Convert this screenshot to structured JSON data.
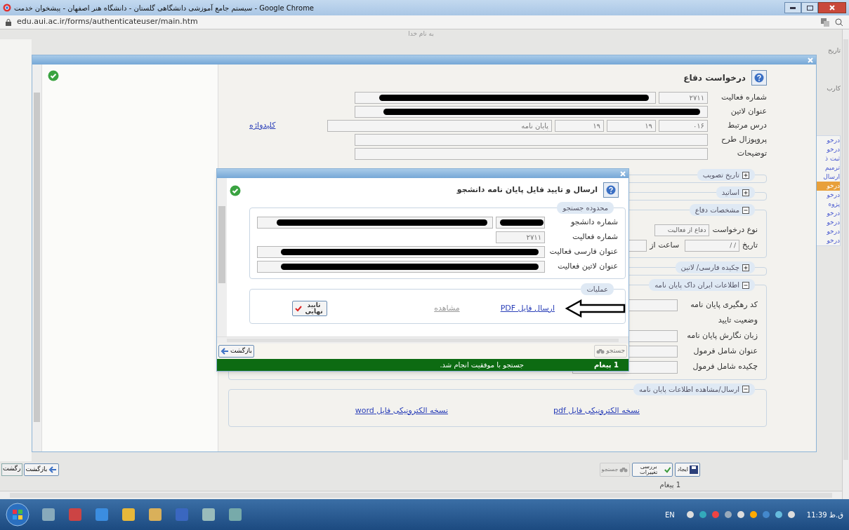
{
  "browser": {
    "title": "سیستم جامع آموزشی دانشگاهی گلستان - دانشگاه هنر اصفهان - پیشخوان خدمت - Google Chrome",
    "url": "edu.aui.ac.ir/forms/authenticateuser/main.htm"
  },
  "page": {
    "header": "به نام خدا",
    "corner_labels": [
      "تاریخ",
      "کارب"
    ],
    "side_links": [
      {
        "label": "درخو",
        "selected": false
      },
      {
        "label": "درخو",
        "selected": false
      },
      {
        "label": "ثبت ذ",
        "selected": false
      },
      {
        "label": "ترمیم",
        "selected": false
      },
      {
        "label": "ارسال",
        "selected": false
      },
      {
        "label": "درخو",
        "selected": true
      },
      {
        "label": "درخو",
        "selected": false
      },
      {
        "label": "پژوه",
        "selected": false
      },
      {
        "label": "درخو",
        "selected": false
      },
      {
        "label": "درخو",
        "selected": false
      },
      {
        "label": "درخو",
        "selected": false
      },
      {
        "label": "درخو",
        "selected": false
      }
    ],
    "back_buttons": [
      "بازگشت",
      "رگشت"
    ],
    "toolbar": [
      {
        "kind": "create",
        "label": "ایجاد",
        "disabled": false
      },
      {
        "kind": "review",
        "label": "بررسی تغییرات",
        "disabled": false
      },
      {
        "kind": "search",
        "label": "جستجو",
        "disabled": true
      }
    ],
    "messages": "1 پیغام"
  },
  "defense_dialog": {
    "title": "درخواست دفاع",
    "fields": [
      {
        "label": "شماره فعالیت",
        "inputs": [
          {
            "kind": "code",
            "value": "۲۷۱۱"
          },
          {
            "kind": "text",
            "redacted": true
          }
        ]
      },
      {
        "label": "عنوان لاتین",
        "inputs": [
          {
            "kind": "text",
            "redacted": true
          }
        ]
      },
      {
        "label": "درس مرتبط",
        "inputs": [
          {
            "kind": "code",
            "value": "۰۱۶"
          },
          {
            "kind": "code",
            "value": "۱۹"
          },
          {
            "kind": "code",
            "value": "۱۹"
          },
          {
            "kind": "text",
            "value": "پایان نامه"
          }
        ],
        "link": "کلیدواژه"
      },
      {
        "label": "پروپوزال طرح",
        "inputs": [
          {
            "kind": "text"
          }
        ]
      },
      {
        "label": "توضیحات",
        "inputs": [
          {
            "kind": "text"
          }
        ]
      }
    ],
    "sections": [
      {
        "title": "تاریخ تصویب",
        "expanded": false
      },
      {
        "title": "اساتید",
        "expanded": false
      },
      {
        "title": "مشخصات دفاع",
        "expanded": true,
        "rows": [
          {
            "kind": "field",
            "label": "نوع درخواست",
            "value": "دفاع از فعالیت"
          },
          {
            "kind": "field",
            "label": "تاریخ",
            "value": "/ /",
            "extra_label": "ساعت از"
          }
        ]
      },
      {
        "title": "چکیده فارسی/ لاتین",
        "expanded": false
      },
      {
        "title": "اطلاعات ایران داک پایان نامه",
        "expanded": true,
        "rows": [
          {
            "kind": "field",
            "label": "کد رهگیری پایان نامه"
          },
          {
            "kind": "text",
            "label": "وضعیت تایید"
          },
          {
            "kind": "field",
            "label": "زبان نگارش پایان نامه"
          },
          {
            "kind": "field",
            "label": "عنوان شامل فرمول"
          },
          {
            "kind": "select",
            "label": "چکیده شامل فرمول"
          }
        ]
      },
      {
        "title": "ارسال/مشاهده اطلاعات پایان نامه",
        "expanded": true,
        "links": [
          "نسخه الکترونیکی فایل pdf",
          "نسخه الکترونیکی فایل word"
        ]
      }
    ]
  },
  "upload_dialog": {
    "title": "ارسال و تایید فایل پایان نامه دانشجو",
    "search_legend": "محدوده جستجو",
    "fields": [
      {
        "label": "شماره دانشجو",
        "inputs": [
          {
            "kind": "code",
            "redacted": true
          },
          {
            "kind": "text",
            "redacted": true
          }
        ]
      },
      {
        "label": "شماره فعالیت",
        "inputs": [
          {
            "kind": "code",
            "value": "۲۷۱۱"
          }
        ]
      },
      {
        "label": "عنوان فارسی فعالیت",
        "inputs": [
          {
            "kind": "text",
            "redacted": true
          }
        ]
      },
      {
        "label": "عنوان لاتین فعالیت",
        "inputs": [
          {
            "kind": "text",
            "redacted": true
          }
        ]
      }
    ],
    "ops_legend": "عملیات",
    "upload_link": "ارسال فایل PDF",
    "view_link": {
      "label": "مشاهده",
      "disabled": true
    },
    "confirm_button": "تایید نهایی",
    "back_button": "بازگشت",
    "search_button": {
      "label": "جستجو",
      "disabled": true
    },
    "status": {
      "count": "1 پیغام",
      "message": "جستجو با موفقیت انجام شد."
    }
  },
  "taskbar": {
    "language": "EN",
    "time": "11:39 ق.ظ"
  }
}
